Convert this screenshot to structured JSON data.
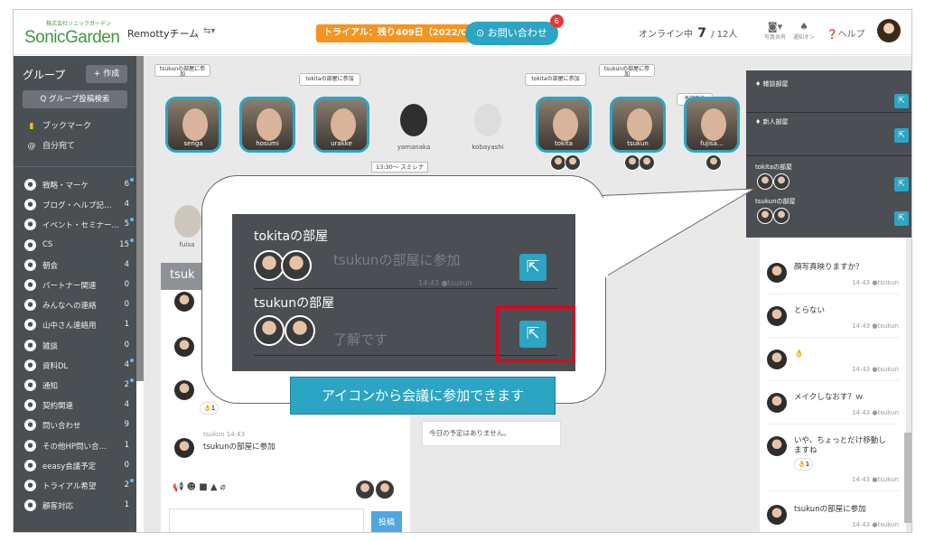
{
  "header": {
    "logo_sub": "株式会社ソニックガーデン",
    "logo_name": "SonicGarden",
    "team_name": "Remottyチーム",
    "team_menu": "⇆▾",
    "trial": "トライアル：残り409日（2022/09/30迄）",
    "contact": "お問い合わせ",
    "contact_badge": "6",
    "online_label": "オンライン中",
    "online_count": "7",
    "online_total": "/ 12人",
    "photo_label": "写真共有",
    "notify_label": "通知オン",
    "help": "ヘルプ"
  },
  "sidebar": {
    "title": "グループ",
    "create": "+ 作成",
    "search": "Q グループ投稿検索",
    "bookmark": "ブックマーク",
    "self": "自分宛て",
    "groups": [
      {
        "label": "戦略・マーケ",
        "count": "6",
        "dot": true
      },
      {
        "label": "ブログ・ヘルプ記…",
        "count": "4",
        "dot": false
      },
      {
        "label": "イベント・セミナー…",
        "count": "5",
        "dot": true
      },
      {
        "label": "CS",
        "count": "15",
        "dot": true
      },
      {
        "label": "朝会",
        "count": "4",
        "dot": false
      },
      {
        "label": "パートナー関連",
        "count": "0",
        "dot": false
      },
      {
        "label": "みんなへの連絡",
        "count": "0",
        "dot": false
      },
      {
        "label": "山中さん連絡用",
        "count": "1",
        "dot": false
      },
      {
        "label": "雑談",
        "count": "0",
        "dot": false
      },
      {
        "label": "資料DL",
        "count": "4",
        "dot": true
      },
      {
        "label": "通知",
        "count": "2",
        "dot": true
      },
      {
        "label": "契約関連",
        "count": "4",
        "dot": false
      },
      {
        "label": "問い合わせ",
        "count": "9",
        "dot": false
      },
      {
        "label": "その他HP問い合…",
        "count": "1",
        "dot": false
      },
      {
        "label": "eeasy会議予定",
        "count": "0",
        "dot": false
      },
      {
        "label": "トライアル希望",
        "count": "2",
        "dot": true
      },
      {
        "label": "顧客対応",
        "count": "1",
        "dot": false
      }
    ]
  },
  "room_labels": {
    "tsukun_join_a": "tsukunの部屋に参加",
    "tokita_join_a": "tokitaの部屋に参加",
    "tokita_join_b": "tokitaの部屋に参加",
    "tsukun_join_b": "tsukunの部屋に参加",
    "scheduled": "予定あり"
  },
  "avatars": {
    "senga": "senga",
    "hosumi": "hosumi",
    "urakke": "urakke",
    "yamanaka": "yamanaka",
    "kobayashi": "kobayashi",
    "tokita": "tokita",
    "tsukun": "tsukun",
    "fujisaki": "fujisa…",
    "fuisa": "fuisa"
  },
  "time_badge": "13:30～ スミレナ",
  "chat": {
    "head": "tsuk",
    "msg_meta": "tsukun 14:43",
    "msg_text": "tsukunの部屋に参加",
    "reaction": "👌1",
    "post": "投稿",
    "tools": "📢 ☻ ■ ▲ ⌀"
  },
  "schedule_empty": "今日の予定はありません。",
  "timeline": [
    {
      "text": "顔写真映りますか？",
      "time": "14:43 ●tsukun"
    },
    {
      "text": "とらない",
      "time": "14:43 ●tsukun"
    },
    {
      "text": "👌",
      "time": "14:43 ●tsukun"
    },
    {
      "text": "メイクしなおす？ｗ",
      "time": "14:43 ●tsukun"
    },
    {
      "text": "いや、ちょっとだけ移動しますね",
      "time": "14:43 ●tsukun",
      "reaction": "👌1"
    },
    {
      "text": "tsukunの部屋に参加",
      "time": "14:43 ●tsukun"
    }
  ],
  "popup": {
    "chat_room": "雑談部屋",
    "new_room": "新人部屋",
    "tokita_room": "tokitaの部屋",
    "tsukun_room": "tsukunの部屋",
    "behind_time_a": "14:42 ●tsukun",
    "behind_time_b": "14:42 ●tsukun"
  },
  "zoom": {
    "tokita_room": "tokitaの部屋",
    "tsukun_room": "tsukunの部屋",
    "ghost_join": "tsukunの部屋に参加",
    "ghost_time": "14:43 ●tsukun",
    "ghost_ok": "了解です"
  },
  "caption": "アイコンから会議に参加できます",
  "colors": {
    "accent": "#2ba5c3",
    "sidebar": "#4a4f54",
    "highlight": "#e4001b",
    "trial": "#f7941d",
    "logo": "#3a9a3a"
  }
}
